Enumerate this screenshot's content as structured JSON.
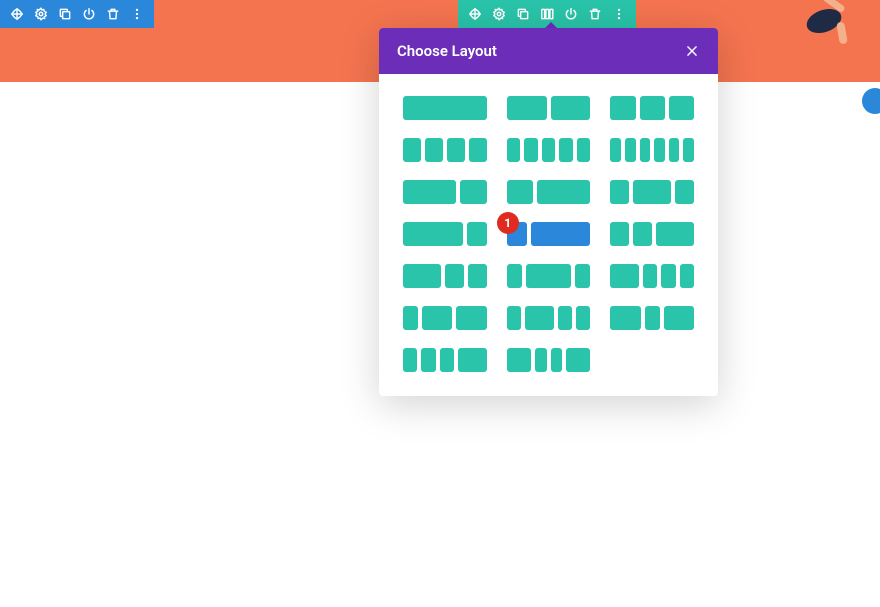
{
  "modal": {
    "title": "Choose Layout",
    "badge": "1"
  },
  "colors": {
    "hero": "#f4744f",
    "section": "#2b87da",
    "row": "#29c4a9",
    "modalHeader": "#6c2eb9",
    "badge": "#e02b20"
  },
  "toolbarIcons": {
    "move": "move-icon",
    "settings": "gear-icon",
    "duplicate": "duplicate-icon",
    "columns": "columns-icon",
    "power": "power-icon",
    "delete": "trash-icon",
    "more": "more-icon"
  },
  "layouts": [
    {
      "cols": [
        1
      ]
    },
    {
      "cols": [
        1,
        1
      ]
    },
    {
      "cols": [
        1,
        1,
        1
      ]
    },
    {
      "cols": [
        1,
        1,
        1,
        1
      ]
    },
    {
      "cols": [
        1,
        1,
        1,
        1,
        1
      ]
    },
    {
      "cols": [
        1,
        1,
        1,
        1,
        1,
        1
      ]
    },
    {
      "cols": [
        2,
        1
      ]
    },
    {
      "cols": [
        1,
        2
      ]
    },
    {
      "cols": [
        1,
        2,
        1
      ]
    },
    {
      "cols": [
        3,
        1
      ]
    },
    {
      "cols": [
        1,
        3
      ],
      "selected": true
    },
    {
      "cols": [
        1,
        1,
        2
      ]
    },
    {
      "cols": [
        2,
        1,
        1
      ]
    },
    {
      "cols": [
        1,
        3,
        1
      ]
    },
    {
      "cols": [
        2,
        1,
        1,
        1
      ]
    },
    {
      "cols": [
        1,
        2,
        2
      ]
    },
    {
      "cols": [
        1,
        2,
        1,
        1
      ]
    },
    {
      "cols": [
        2,
        1,
        2
      ]
    },
    {
      "cols": [
        1,
        1,
        1,
        2
      ]
    },
    {
      "cols": [
        2,
        1,
        1,
        2
      ]
    }
  ]
}
